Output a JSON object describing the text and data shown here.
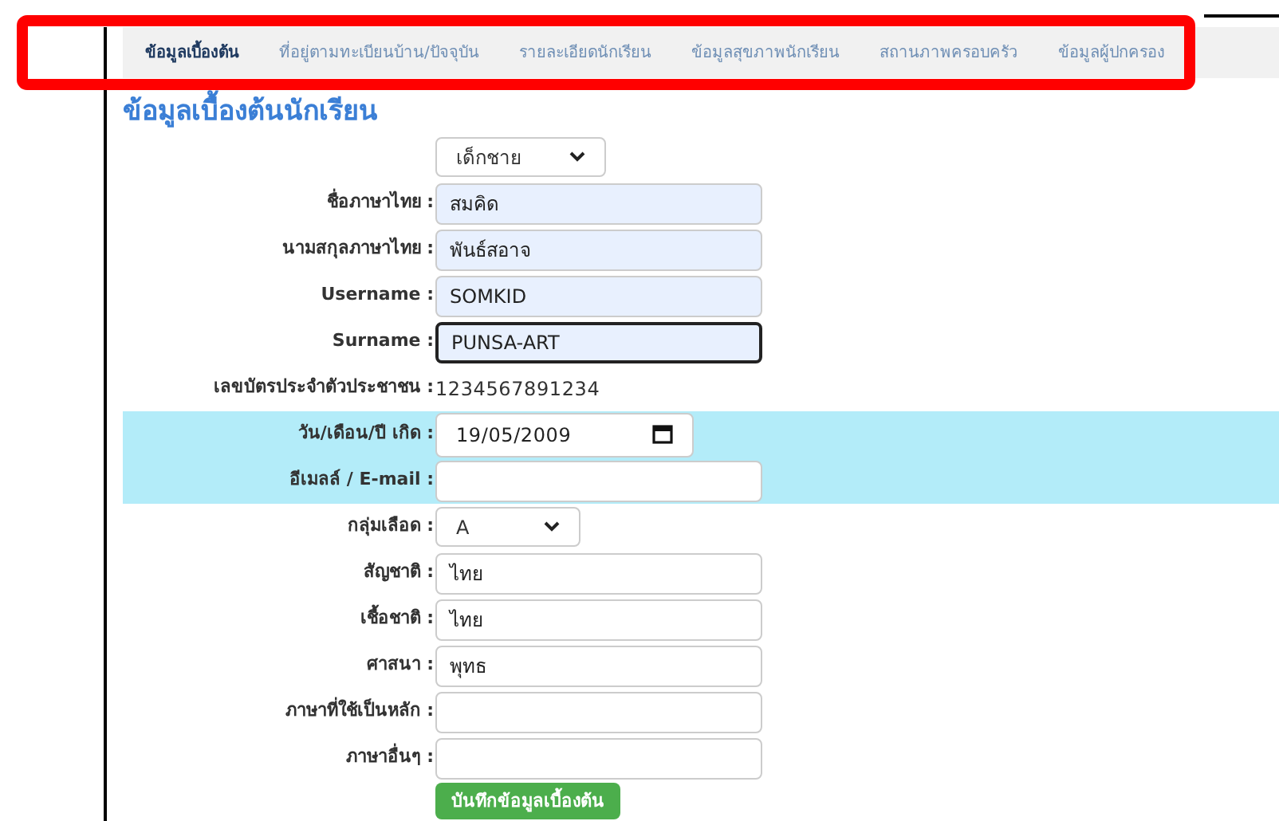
{
  "tabs": [
    {
      "label": "ข้อมูลเบื้องต้น",
      "selected": true
    },
    {
      "label": "ที่อยู่ตามทะเบียนบ้าน/ปัจจุบัน",
      "selected": false
    },
    {
      "label": "รายละเอียดนักเรียน",
      "selected": false
    },
    {
      "label": "ข้อมูลสุขภาพนักเรียน",
      "selected": false
    },
    {
      "label": "สถานภาพครอบครัว",
      "selected": false
    },
    {
      "label": "ข้อมูลผู้ปกครอง",
      "selected": false
    }
  ],
  "heading": "ข้อมูลเบื้องต้นนักเรียน",
  "rows": [
    {
      "kind": "select",
      "value": "เด็กชาย",
      "highlighted": false
    },
    {
      "kind": "text",
      "label": "ชื่อภาษาไทย :",
      "value": "สมคิด",
      "autofilled": true,
      "focused": false,
      "highlighted": false
    },
    {
      "kind": "text",
      "label": "นามสกุลภาษาไทย :",
      "value": "พันธ์สอาจ",
      "autofilled": true,
      "focused": false,
      "highlighted": false
    },
    {
      "kind": "text",
      "label": "Username :",
      "value": "SOMKID",
      "autofilled": true,
      "focused": false,
      "highlighted": false
    },
    {
      "kind": "text",
      "label": "Surname :",
      "value": "PUNSA-ART",
      "autofilled": true,
      "focused": true,
      "highlighted": false
    },
    {
      "kind": "static",
      "label": "เลขบัตรประจำตัวประชาชน :",
      "value": "1234567891234",
      "highlighted": false
    },
    {
      "kind": "date",
      "label": "วัน/เดือน/ปี เกิด :",
      "value": "19/05/2009",
      "highlighted": true
    },
    {
      "kind": "text",
      "label": "อีเมลล์ / E-mail :",
      "autofilled": false,
      "focused": false,
      "highlighted": true
    },
    {
      "kind": "select",
      "label": "กลุ่มเลือด :",
      "value": "A",
      "highlighted": false
    },
    {
      "kind": "text",
      "label": "สัญชาติ :",
      "value": "ไทย",
      "autofilled": false,
      "focused": false,
      "highlighted": false
    },
    {
      "kind": "text",
      "label": "เชื้อชาติ :",
      "value": "ไทย",
      "autofilled": false,
      "focused": false,
      "highlighted": false
    },
    {
      "kind": "text",
      "label": "ศาสนา :",
      "value": "พุทธ",
      "autofilled": false,
      "focused": false,
      "highlighted": false
    },
    {
      "kind": "text",
      "label": "ภาษาที่ใช้เป็นหลัก :",
      "autofilled": false,
      "focused": false,
      "highlighted": false
    },
    {
      "kind": "text",
      "label": "ภาษาอื่นๆ :",
      "autofilled": false,
      "focused": false,
      "highlighted": false
    }
  ],
  "save_button": "บันทึกข้อมูลเบื้องต้น"
}
